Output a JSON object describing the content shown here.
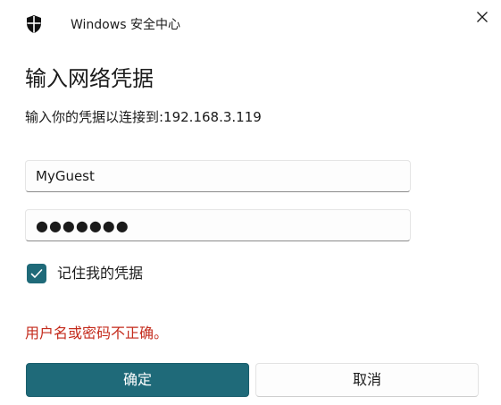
{
  "window": {
    "app_title": "Windows 安全中心",
    "app_icon": "shield-icon",
    "close_icon": "close-icon"
  },
  "dialog": {
    "heading": "输入网络凭据",
    "subtitle": "输入你的凭据以连接到:192.168.3.119",
    "username_value": "MyGuest",
    "password_masked": "●●●●●●●",
    "remember_checked": true,
    "remember_label": "记住我的凭据",
    "error_message": "用户名或密码不正确。",
    "ok_label": "确定",
    "cancel_label": "取消"
  },
  "colors": {
    "accent": "#1f6a79",
    "error": "#c42b1c"
  }
}
